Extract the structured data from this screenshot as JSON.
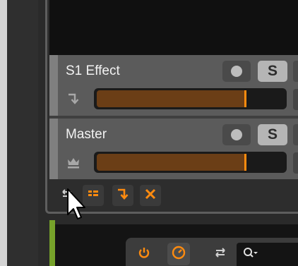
{
  "tracks": [
    {
      "name": "S1 Effect",
      "icon": "return-arrow-icon",
      "volume_fraction": 0.8,
      "solo_label": "S"
    },
    {
      "name": "Master",
      "icon": "crown-icon",
      "volume_fraction": 0.8,
      "solo_label": "S"
    }
  ],
  "toolbar": {
    "buttons": [
      "swap-arrows-icon",
      "list-view-icon",
      "return-arrow-icon",
      "close-icon"
    ]
  },
  "lower_toolbar": {
    "buttons": [
      "power-icon",
      "gauge-icon",
      "swap-arrows-icon"
    ],
    "search_icon": "search-dropdown-icon"
  },
  "colors": {
    "accent": "#ff8b0f",
    "fader_fill": "#6b3e16",
    "track_bg": "#5b5b5b",
    "green_strip": "#76a22a"
  }
}
